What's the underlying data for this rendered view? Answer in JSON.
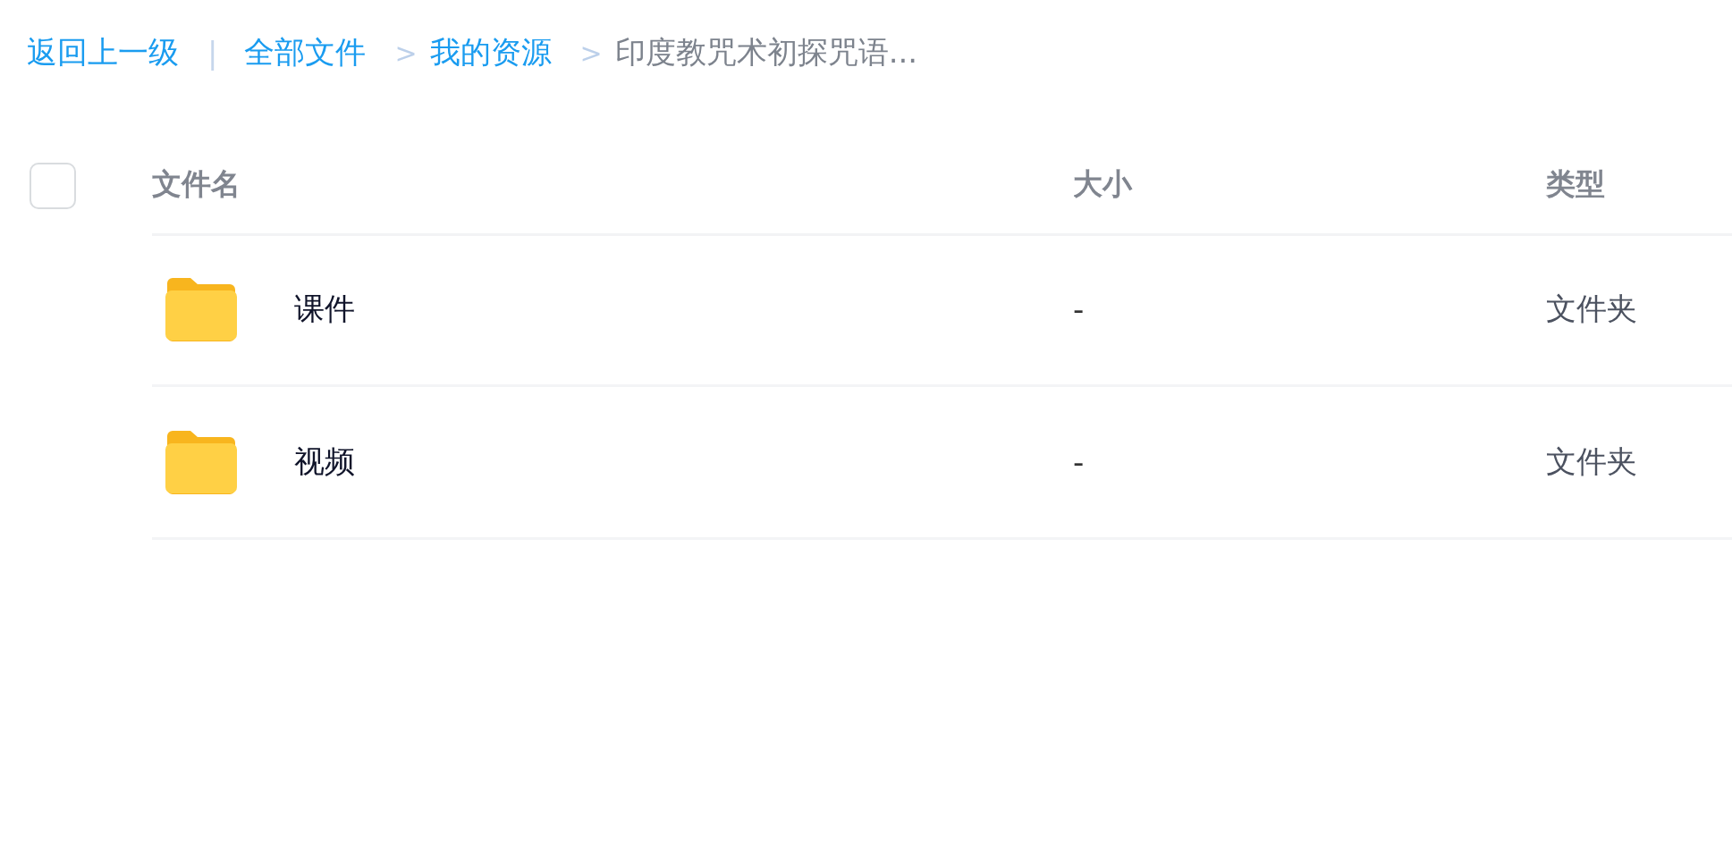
{
  "breadcrumb": {
    "back": "返回上一级",
    "separator": "|",
    "items": [
      {
        "label": "全部文件",
        "current": false
      },
      {
        "label": "我的资源",
        "current": false
      },
      {
        "label": "印度教咒术初探咒语...",
        "current": true
      }
    ],
    "arrow": ">"
  },
  "table": {
    "select_all": {
      "checked": false
    },
    "columns": [
      "文件名",
      "大小",
      "类型"
    ],
    "rows": [
      {
        "name": "课件",
        "size": "-",
        "type": "文件夹",
        "kind": "folder"
      },
      {
        "name": "视频",
        "size": "-",
        "type": "文件夹",
        "kind": "folder"
      }
    ]
  }
}
